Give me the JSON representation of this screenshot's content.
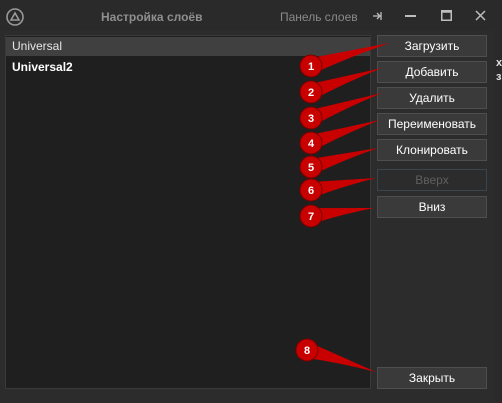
{
  "titlebar": {
    "title": "Настройка слоёв",
    "panel_tab": "Панель слоев"
  },
  "layers": [
    {
      "name": "Universal",
      "selected": true
    },
    {
      "name": "Universal2",
      "selected": false
    }
  ],
  "buttons": {
    "load": "Загрузить",
    "add": "Добавить",
    "delete": "Удалить",
    "rename": "Переименовать",
    "clone": "Клонировать",
    "up": "Вверх",
    "down": "Вниз",
    "close": "Закрыть"
  },
  "markers": [
    "1",
    "2",
    "3",
    "4",
    "5",
    "6",
    "7",
    "8"
  ],
  "side_fragments": [
    "х",
    "з"
  ],
  "colors": {
    "marker": "#c80000",
    "window_bg": "#2c2c2c",
    "list_bg": "#1f1f1f",
    "button_bg": "#3a3a3a"
  }
}
